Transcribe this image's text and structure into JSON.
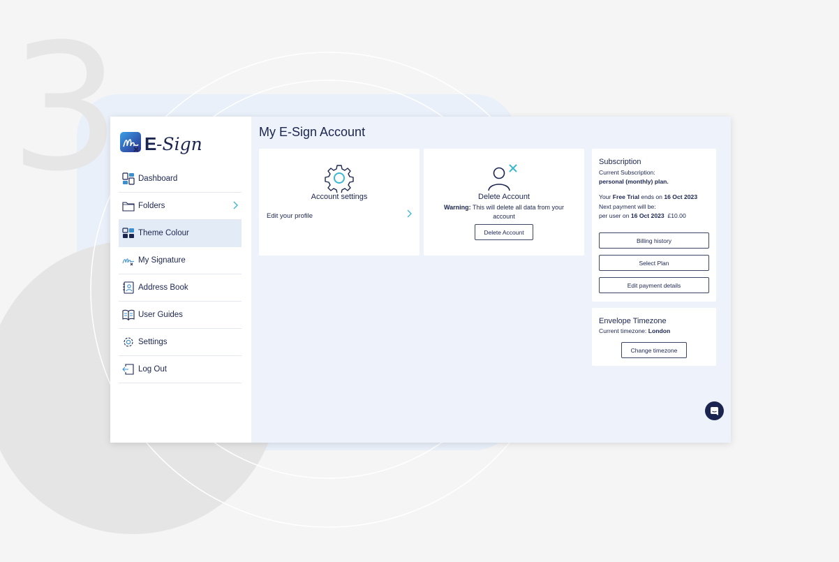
{
  "decor": {
    "step_number": "3"
  },
  "colors": {
    "navy": "#1b2550",
    "accent": "#3db7d0",
    "panel_bg": "#eef3fb",
    "active_bg": "#e3ebf6"
  },
  "brand": {
    "name": "E-Sign"
  },
  "sidebar": {
    "items": [
      {
        "label": "Dashboard",
        "icon": "dashboard-icon"
      },
      {
        "label": "Folders",
        "icon": "folder-icon",
        "has_chevron": true
      },
      {
        "label": "Theme Colour",
        "icon": "theme-icon",
        "active": true
      },
      {
        "label": "My Signature",
        "icon": "signature-icon"
      },
      {
        "label": "Address Book",
        "icon": "address-book-icon"
      },
      {
        "label": "User Guides",
        "icon": "book-icon"
      },
      {
        "label": "Settings",
        "icon": "gear-icon"
      },
      {
        "label": "Log Out",
        "icon": "logout-icon"
      }
    ]
  },
  "main": {
    "title": "My E-Sign Account",
    "account_card": {
      "heading": "Account settings",
      "link": "Edit your profile"
    },
    "delete_card": {
      "heading": "Delete Account",
      "warning_label": "Warning:",
      "warning_text": " This will delete all data from your account",
      "button": "Delete Account"
    },
    "subscription": {
      "title": "Subscription",
      "current_label": "Current Subscription:",
      "plan": "personal (monthly) plan.",
      "trial_prefix": "Your ",
      "trial_bold": "Free Trial",
      "trial_mid": " ends on ",
      "trial_date": "16 Oct 2023",
      "next_payment": "Next payment will be:",
      "per_user_prefix": "per user on ",
      "per_user_date": "16 Oct 2023",
      "amount": "£10.00",
      "buttons": [
        "Billing history",
        "Select Plan",
        "Edit payment details"
      ]
    },
    "timezone": {
      "title": "Envelope Timezone",
      "current_label": "Current timezone: ",
      "current_value": "London",
      "button": "Change timezone"
    }
  }
}
